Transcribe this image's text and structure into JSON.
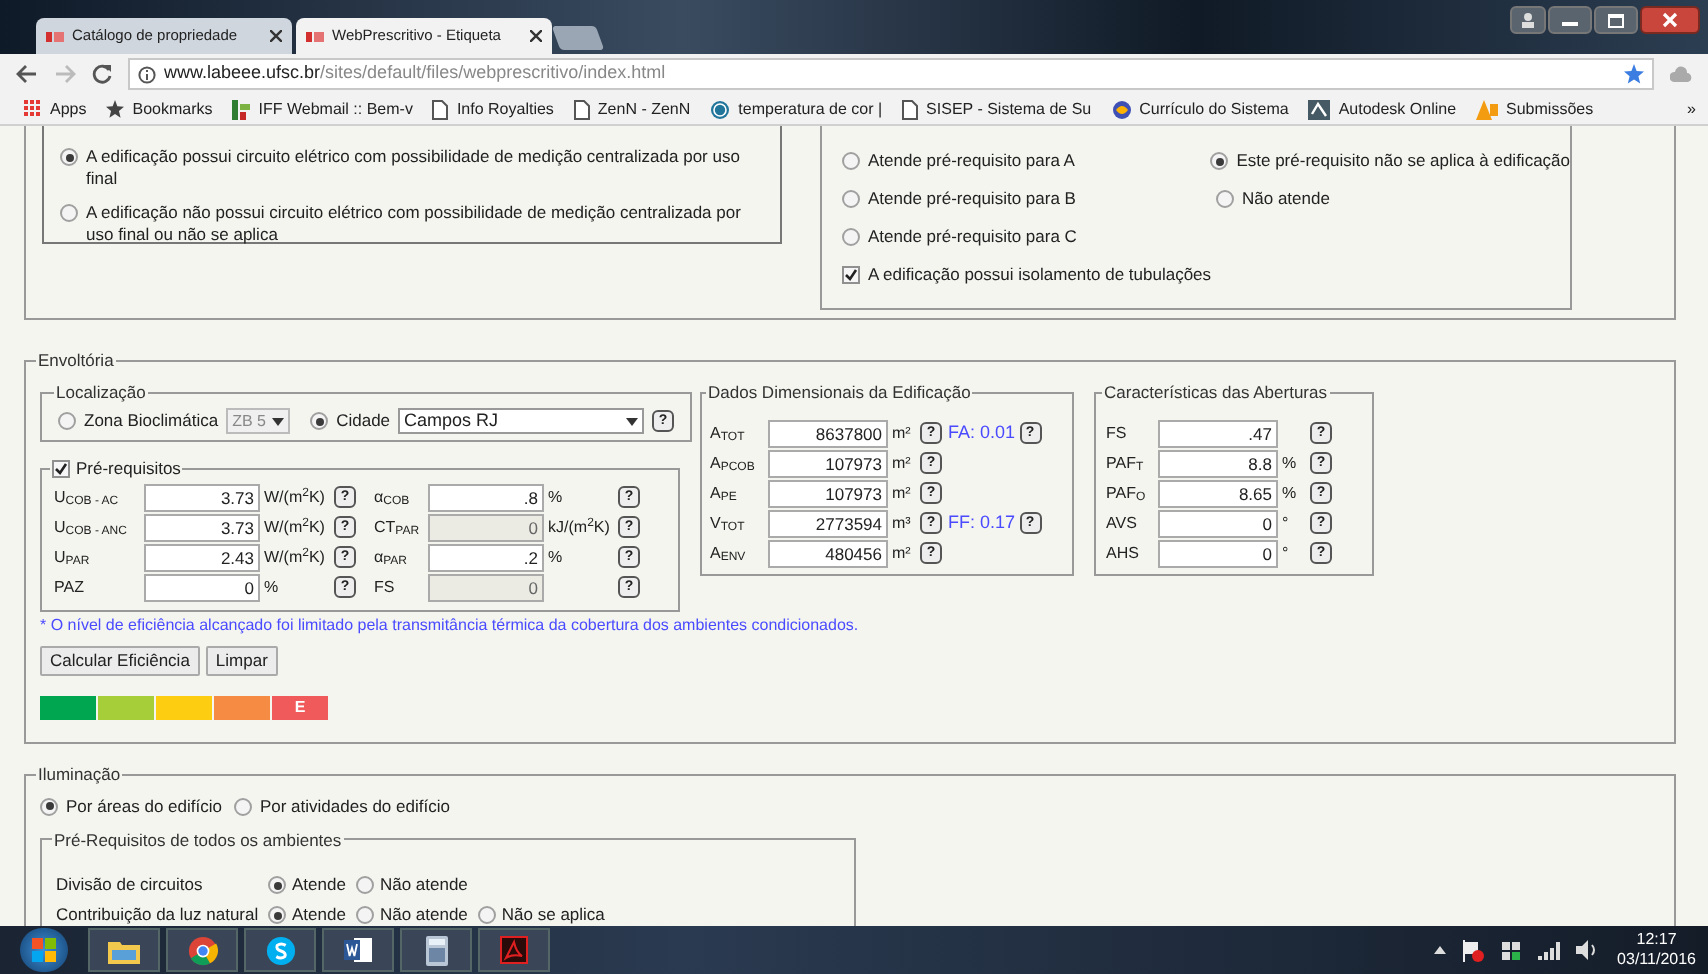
{
  "tabs": [
    {
      "title": "Catálogo de propriedade",
      "selected": false
    },
    {
      "title": "WebPrescritivo - Etiqueta",
      "selected": true
    }
  ],
  "address": {
    "host": "www.labeee.ufsc.br",
    "path": "/sites/default/files/webprescritivo/index.html"
  },
  "bookmarks": [
    "Apps",
    "Bookmarks",
    "IFF Webmail :: Bem-v",
    "Info Royalties",
    "ZenN - ZenN",
    "temperatura de cor |",
    "SISEP - Sistema de Su",
    "Currículo do Sistema",
    "Autodesk Online",
    "Submissões"
  ],
  "bookmarks_more": "»",
  "metering": {
    "options": [
      {
        "label": "A edificação possui circuito elétrico com possibilidade de medição centralizada por uso final",
        "selected": true
      },
      {
        "label": "A edificação não possui circuito elétrico com possibilidade de medição centralizada por uso final ou não se aplica",
        "selected": false
      }
    ]
  },
  "requirements": {
    "rows": [
      [
        {
          "kind": "radio",
          "label": "Atende pré-requisito para A",
          "selected": false
        },
        {
          "kind": "radio",
          "label": "Este pré-requisito não se aplica à edificação",
          "selected": true
        }
      ],
      [
        {
          "kind": "radio",
          "label": "Atende pré-requisito para B",
          "selected": false
        },
        {
          "kind": "radio",
          "label": "Não atende",
          "selected": false
        }
      ],
      [
        {
          "kind": "radio",
          "label": "Atende pré-requisito para C",
          "selected": false
        }
      ],
      [
        {
          "kind": "checkbox",
          "label": "A edificação possui isolamento de tubulações",
          "selected": true
        }
      ]
    ]
  },
  "envoltoria": {
    "legend": "Envoltória",
    "localizacao": {
      "legend": "Localização",
      "zone": {
        "label": "Zona Bioclimática",
        "selected": false,
        "value": "ZB 5",
        "disabled": true
      },
      "city": {
        "label": "Cidade",
        "selected": true,
        "value": "Campos RJ"
      },
      "help": "?"
    },
    "prerequisitos": {
      "legend": "Pré-requisitos",
      "checked": true,
      "rows": [
        [
          {
            "label": "U$_{COB - AC}$",
            "value": "3.73",
            "unit": "W/(m$^{2}$K)",
            "help": "?",
            "disabled": false
          },
          {
            "label": "α$_{COB}$",
            "value": ".8",
            "unit": "%",
            "help": "?",
            "disabled": false
          }
        ],
        [
          {
            "label": "U$_{COB - ANC}$",
            "value": "3.73",
            "unit": "W/(m$^{2}$K)",
            "help": "?",
            "disabled": false
          },
          {
            "label": "CT$_{PAR}$",
            "value": "0",
            "unit": "kJ/(m$^{2}$K)",
            "help": "?",
            "disabled": true
          }
        ],
        [
          {
            "label": "U$_{PAR}$",
            "value": "2.43",
            "unit": "W/(m$^{2}$K)",
            "help": "?",
            "disabled": false
          },
          {
            "label": "α$_{PAR}$",
            "value": ".2",
            "unit": "%",
            "help": "?",
            "disabled": false
          }
        ],
        [
          {
            "label": "PAZ",
            "value": "0",
            "unit": "%",
            "help": "?",
            "disabled": false
          },
          {
            "label": "FS",
            "value": "0",
            "help": "?",
            "disabled": true
          }
        ]
      ]
    },
    "note": "* O nível de eficiência alcançado foi limitado pela transmitância térmica da cobertura dos ambientes condicionados.",
    "buttons": [
      "Calcular Eficiência",
      "Limpar"
    ],
    "scale": [
      {
        "color": "#00a650"
      },
      {
        "color": "#a6ce39"
      },
      {
        "color": "#fccd11"
      },
      {
        "color": "#f68b44"
      },
      {
        "color": "#f05a5b",
        "label": "E"
      }
    ],
    "dimensional": {
      "legend": "Dados Dimensionais da Edificação",
      "rows": [
        {
          "label": "A$_{TOT}$",
          "value": "8637800",
          "unit": "m²",
          "help": "?",
          "extra": "FA: 0.01",
          "extra_help": "?"
        },
        {
          "label": "A$_{PCOB}$",
          "value": "107973",
          "unit": "m²",
          "help": "?"
        },
        {
          "label": "A$_{PE}$",
          "value": "107973",
          "unit": "m²",
          "help": "?"
        },
        {
          "label": "V$_{TOT}$",
          "value": "2773594",
          "unit": "m³",
          "help": "?",
          "extra": "FF: 0.17",
          "extra_help": "?"
        },
        {
          "label": "A$_{ENV}$",
          "value": "480456",
          "unit": "m²",
          "help": "?"
        }
      ]
    },
    "openings": {
      "legend": "Características das Aberturas",
      "rows": [
        {
          "label": "FS",
          "value": ".47",
          "help": "?"
        },
        {
          "label": "PAF$_{T}$",
          "value": "8.8",
          "unit": "%",
          "help": "?"
        },
        {
          "label": "PAF$_{O}$",
          "value": "8.65",
          "unit": "%",
          "help": "?"
        },
        {
          "label": "AVS",
          "value": "0",
          "unit": "°",
          "help": "?"
        },
        {
          "label": "AHS",
          "value": "0",
          "unit": "°",
          "help": "?"
        }
      ]
    }
  },
  "iluminacao": {
    "legend": "Iluminação",
    "modes": [
      {
        "label": "Por áreas do edifício",
        "selected": true
      },
      {
        "label": "Por atividades do edifício",
        "selected": false
      }
    ],
    "prerequisitos": {
      "legend": "Pré-Requisitos de todos os ambientes",
      "rows": [
        {
          "label": "Divisão de circuitos",
          "options": [
            {
              "label": "Atende",
              "selected": true
            },
            {
              "label": "Não atende",
              "selected": false
            }
          ]
        },
        {
          "label": "Contribuição da luz natural",
          "options": [
            {
              "label": "Atende",
              "selected": true
            },
            {
              "label": "Não atende",
              "selected": false
            },
            {
              "label": "Não se aplica",
              "selected": false
            }
          ]
        }
      ]
    }
  },
  "clock": {
    "time": "12:17",
    "date": "03/11/2016"
  }
}
